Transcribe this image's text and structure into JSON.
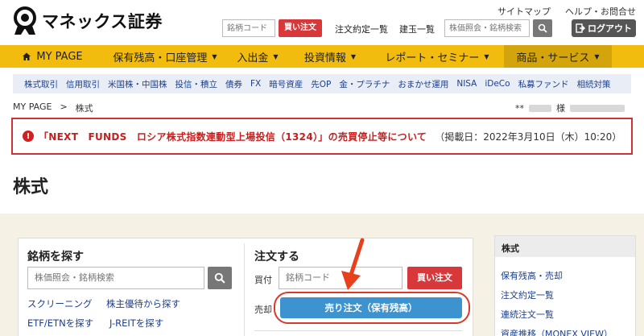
{
  "header": {
    "logo_text": "マネックス証券",
    "top_links": [
      "サイトマップ",
      "ヘルプ・お問合せ"
    ],
    "code_placeholder": "銘柄コード",
    "buy_label": "買い注文",
    "order_list_label": "注文約定一覧",
    "position_list_label": "建玉一覧",
    "search_placeholder": "株価照会・銘柄検索",
    "logout_label": "ログアウト"
  },
  "mainnav": {
    "items": [
      {
        "label": "MY PAGE",
        "has_caret": false
      },
      {
        "label": "保有残高・口座管理",
        "has_caret": true
      },
      {
        "label": "入出金",
        "has_caret": true
      },
      {
        "label": "投資情報",
        "has_caret": true
      },
      {
        "label": "レポート・セミナー",
        "has_caret": true
      },
      {
        "label": "商品・サービス",
        "has_caret": true
      }
    ],
    "active_index": 5
  },
  "subnav": {
    "items": [
      "株式取引",
      "信用取引",
      "米国株・中国株",
      "投信・積立",
      "債券",
      "FX",
      "暗号資産",
      "先OP",
      "金・プラチナ",
      "おまかせ運用",
      "NISA",
      "iDeCo",
      "私募ファンド",
      "相続対策"
    ]
  },
  "breadcrumb": {
    "items": [
      "MY PAGE",
      "株式"
    ],
    "separator": ">"
  },
  "user": {
    "prefix": "**",
    "suffix": "様"
  },
  "alert": {
    "icon": "!",
    "title": "「NEXT　FUNDS　ロシア株式指数連動型上場投信（1324）」の売買停止等について",
    "date": "（掲載日：2022年3月10日（木）10:20）"
  },
  "page": {
    "title": "株式"
  },
  "search_section": {
    "title": "銘柄を探す",
    "placeholder": "株価照会・銘柄検索",
    "links": [
      "スクリーニング",
      "株主優待から探す",
      "ETF/ETNを探す",
      "J-REITを探す"
    ]
  },
  "order_section": {
    "title": "注文する",
    "buy_label": "買付",
    "code_placeholder": "銘柄コード",
    "buy_button": "買い注文",
    "sell_label": "売却",
    "sell_button": "売り注文（保有残高）"
  },
  "side_panel": {
    "title": "株式",
    "links": [
      "保有残高・売却",
      "注文約定一覧",
      "連続注文一覧",
      "資産推移（MONEX VIEW）"
    ]
  },
  "colors": {
    "nav_yellow": "#f1bc0e",
    "buy_red": "#d8383a",
    "sell_blue": "#3d93cf",
    "alert_red": "#c81e1e",
    "link_blue": "#1d3f8c"
  }
}
